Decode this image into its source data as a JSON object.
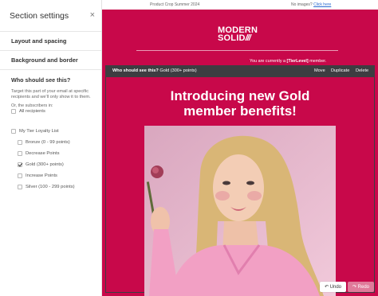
{
  "sidebar": {
    "title": "Section settings",
    "sections": [
      "Layout and spacing",
      "Background and border"
    ],
    "visibility": {
      "heading": "Who should see this?",
      "description": "Target this part of your email at specific recipients and we'll only show it to them.",
      "subheading": "Or, the subscribers in:",
      "options": [
        {
          "label": "All recipients",
          "checked": false
        },
        {
          "label": "My Tier Loyalty List",
          "checked": false
        },
        {
          "label": "Bronze (0 - 99 points)",
          "checked": false
        },
        {
          "label": "Decrease Points",
          "checked": false
        },
        {
          "label": "Gold (300+ points)",
          "checked": true
        },
        {
          "label": "Increase Points",
          "checked": false
        },
        {
          "label": "Silver (100 - 299 points)",
          "checked": false
        }
      ]
    }
  },
  "preview": {
    "topbar": {
      "crop_label": "Product Crop Summer 2024",
      "no_images_text": "No images?",
      "click_here": "Click here"
    },
    "logo": {
      "line1": "MODERN",
      "line2": "SOLID",
      "stripes": "///"
    },
    "member_prefix": "You are currently a ",
    "member_tag": "[TierLevel]",
    "member_suffix": " member.",
    "edit_bar": {
      "who_label": "Who should see this?",
      "who_value": "Gold (300+ points)",
      "actions": [
        "Move",
        "Duplicate",
        "Delete"
      ]
    },
    "headline": "Introducing new Gold member benefits!",
    "undo_label": "Undo",
    "redo_label": "Redo"
  },
  "colors": {
    "brand": "#c8084a",
    "edit_bar": "#3d3d41",
    "redo": "#e07a9a"
  }
}
